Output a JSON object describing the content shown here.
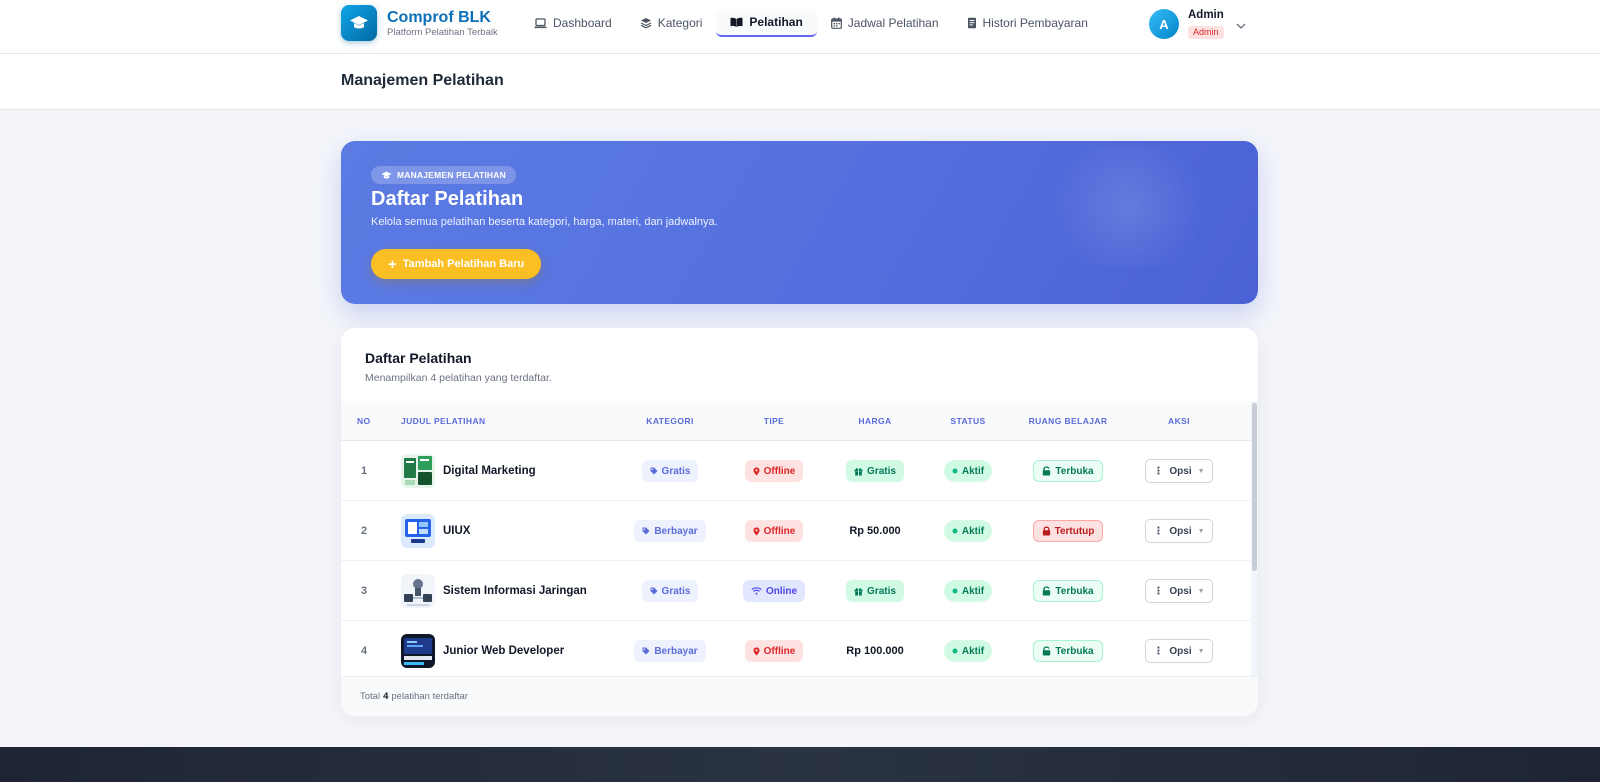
{
  "brand": {
    "name": "Comprof BLK",
    "tagline": "Platform Pelatihan Terbaik",
    "icon": "graduation-cap-icon"
  },
  "nav": {
    "items": [
      {
        "label": "Dashboard",
        "icon": "laptop-icon",
        "active": false
      },
      {
        "label": "Kategori",
        "icon": "layers-icon",
        "active": false
      },
      {
        "label": "Pelatihan",
        "icon": "book-open-icon",
        "active": true
      },
      {
        "label": "Jadwal Pelatihan",
        "icon": "calendar-icon",
        "active": false
      },
      {
        "label": "Histori Pembayaran",
        "icon": "receipt-icon",
        "active": false
      }
    ]
  },
  "user": {
    "initial": "A",
    "name": "Admin",
    "role": "Admin"
  },
  "page": {
    "title": "Manajemen Pelatihan"
  },
  "hero": {
    "badge": "MANAJEMEN PELATIHAN",
    "title": "Daftar Pelatihan",
    "description": "Kelola semua pelatihan beserta kategori, harga, materi, dan jadwalnya.",
    "button_label": "Tambah Pelatihan Baru"
  },
  "table": {
    "title": "Daftar Pelatihan",
    "subtitle": "Menampilkan 4 pelatihan yang terdaftar.",
    "columns": [
      "NO",
      "JUDUL PELATIHAN",
      "KATEGORI",
      "TIPE",
      "HARGA",
      "STATUS",
      "RUANG BELAJAR",
      "AKSI"
    ],
    "rows": [
      {
        "no": "1",
        "title": "Digital Marketing",
        "kategori": "Gratis",
        "tipe": "Offline",
        "harga": "Gratis",
        "harga_is_free": true,
        "status": "Aktif",
        "ruang": "Terbuka",
        "ruang_open": true,
        "aksi": "Opsi"
      },
      {
        "no": "2",
        "title": "UIUX",
        "kategori": "Berbayar",
        "tipe": "Offline",
        "harga": "Rp 50.000",
        "harga_is_free": false,
        "status": "Aktif",
        "ruang": "Tertutup",
        "ruang_open": false,
        "aksi": "Opsi"
      },
      {
        "no": "3",
        "title": "Sistem Informasi Jaringan",
        "kategori": "Gratis",
        "tipe": "Online",
        "harga": "Gratis",
        "harga_is_free": true,
        "status": "Aktif",
        "ruang": "Terbuka",
        "ruang_open": true,
        "aksi": "Opsi"
      },
      {
        "no": "4",
        "title": "Junior Web Developer",
        "kategori": "Berbayar",
        "tipe": "Offline",
        "harga": "Rp 100.000",
        "harga_is_free": false,
        "status": "Aktif",
        "ruang": "Terbuka",
        "ruang_open": true,
        "aksi": "Opsi"
      }
    ],
    "footer_prefix": "Total",
    "footer_count": "4",
    "footer_suffix": "pelatihan terdaftar"
  },
  "colors": {
    "accent": "#5b7be3",
    "brand": "#0b6fb8",
    "cta": "#fbbf24"
  }
}
